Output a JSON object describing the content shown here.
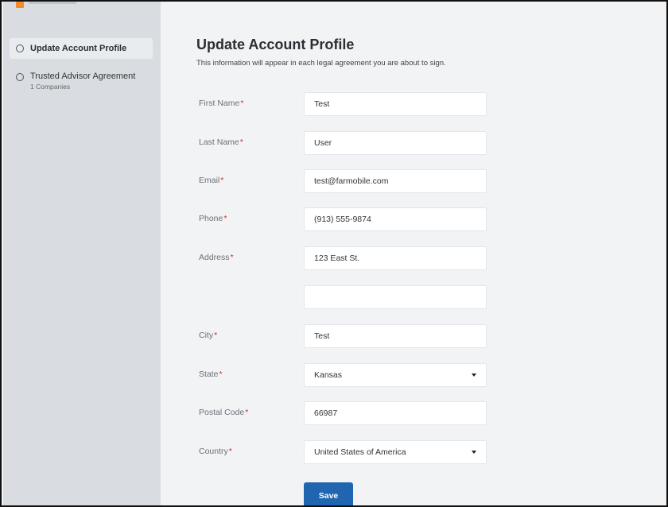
{
  "colors": {
    "sidebar_bg": "#d9dde2",
    "main_bg": "#f1f3f5",
    "primary_button": "#2065b0",
    "required_marker": "#d0302f",
    "logo_accent": "#f28c28"
  },
  "sidebar": {
    "steps": [
      {
        "label": "Update Account Profile",
        "sub": "",
        "active": true
      },
      {
        "label": "Trusted Advisor Agreement",
        "sub": "1 Companies",
        "active": false
      }
    ]
  },
  "main": {
    "title": "Update Account Profile",
    "subtitle": "This information will appear in each legal agreement you are about to sign.",
    "required_marker": "*",
    "fields": [
      {
        "label": "First Name",
        "value": "Test",
        "type": "text"
      },
      {
        "label": "Last Name",
        "value": "User",
        "type": "text"
      },
      {
        "label": "Email",
        "value": "test@farmobile.com",
        "type": "text"
      },
      {
        "label": "Phone",
        "value": "(913) 555-9874",
        "type": "text"
      },
      {
        "label": "Address",
        "value": "123 East St.",
        "type": "text"
      },
      {
        "label": "",
        "value": "",
        "type": "text"
      },
      {
        "label": "City",
        "value": "Test",
        "type": "text"
      },
      {
        "label": "State",
        "value": "Kansas",
        "type": "select"
      },
      {
        "label": "Postal Code",
        "value": "66987",
        "type": "text"
      },
      {
        "label": "Country",
        "value": "United States of America",
        "type": "select"
      }
    ],
    "save_label": "Save"
  }
}
